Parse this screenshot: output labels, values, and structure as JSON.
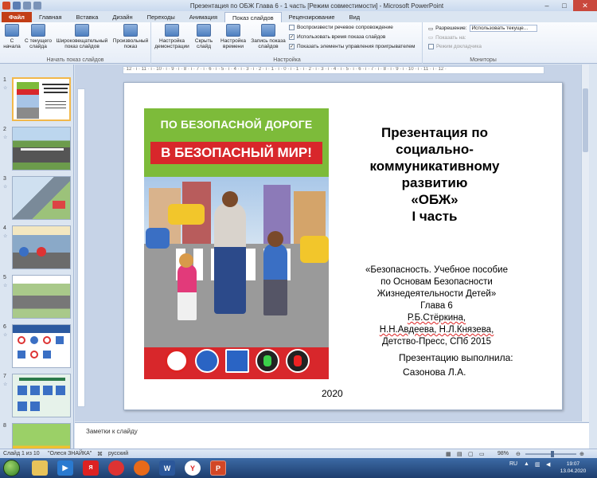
{
  "window": {
    "title": "Презентация по ОБЖ Глава 6 - 1 часть [Режим совместимости] - Microsoft PowerPoint",
    "minimize": "‒",
    "maximize": "□",
    "close": "✕"
  },
  "tabs": [
    "Файл",
    "Главная",
    "Вставка",
    "Дизайн",
    "Переходы",
    "Анимация",
    "Показ слайдов",
    "Рецензирование",
    "Вид"
  ],
  "active_tab": "Показ слайдов",
  "ribbon": {
    "group_start": {
      "label": "Начать показ слайдов",
      "buttons": [
        "С начала",
        "С текущего слайда",
        "Широковещательный показ слайдов",
        "Произвольный показ"
      ]
    },
    "group_setup": {
      "label": "Настройка",
      "buttons": [
        "Настройка демонстрации",
        "Скрыть слайд",
        "Настройка времени",
        "Запись показа слайдов"
      ],
      "checkboxes": [
        {
          "label": "Воспроизвести речевое сопровождение",
          "checked": false
        },
        {
          "label": "Использовать время показа слайдов",
          "checked": true
        },
        {
          "label": "Показать элементы управления проигрывателем",
          "checked": true
        }
      ]
    },
    "group_monitors": {
      "label": "Мониторы",
      "resolution_label": "Разрешение:",
      "resolution_value": "Использовать текуще...",
      "show_on_label": "Показать на:",
      "presenter_view": "Режим докладчика"
    }
  },
  "thumbnails": [
    {
      "num": "1",
      "selected": true
    },
    {
      "num": "2",
      "selected": false
    },
    {
      "num": "3",
      "selected": false
    },
    {
      "num": "4",
      "selected": false
    },
    {
      "num": "5",
      "selected": false
    },
    {
      "num": "6",
      "selected": false
    },
    {
      "num": "7",
      "selected": false
    },
    {
      "num": "8",
      "selected": false
    }
  ],
  "ruler_text": "· 12 · ı · 11 · ı · 10 · ı · 9 · ı · 8 · ı · 7 · ı · 6 · ı · 5 · ı · 4 · ı · 3 · ı · 2 · ı · 1 · ı · 0 · ı · 1 · ı · 2 · ı · 3 · ı · 4 · ı · 5 · ı · 6 · ı · 7 · ı · 8 · ı · 9 · ı · 10 · ı · 11 · ı · 12 ·",
  "slide": {
    "cover_line1": "ПО БЕЗОПАСНОЙ ДОРОГЕ",
    "cover_line2": "В БЕЗОПАСНЫЙ МИР!",
    "title_lines": [
      "Презентация по",
      "социально-",
      "коммуникативному",
      "развитию",
      "«ОБЖ»",
      "I часть"
    ],
    "subtitle_lines": [
      "«Безопасность. Учебное пособие",
      "по Основам Безопасности",
      "Жизнедеятельности Детей»",
      "Глава 6"
    ],
    "authors": [
      "Р.Б.Стёркина,",
      "Н.Н.Авдеева, Н.Л.Князева,"
    ],
    "publisher": "Детство-Пресс, СПб 2015",
    "author_label": "Презентацию выполнила:",
    "author_name": "Сазонова Л.А.",
    "year": "2020"
  },
  "notes_placeholder": "Заметки к слайду",
  "status": {
    "slide_counter": "Слайд 1 из 10",
    "theme": "\"Олеся ЗНАЙКА\"",
    "language": "русский",
    "zoom": "98%",
    "zoom_minus": "⊖",
    "zoom_plus": "⊕"
  },
  "taskbar": {
    "language": "RU",
    "time": "19:07",
    "date": "13.04.2020",
    "apps": [
      "explorer",
      "media",
      "yandex",
      "chrome",
      "avast",
      "word",
      "yandex-browser",
      "powerpoint"
    ]
  }
}
